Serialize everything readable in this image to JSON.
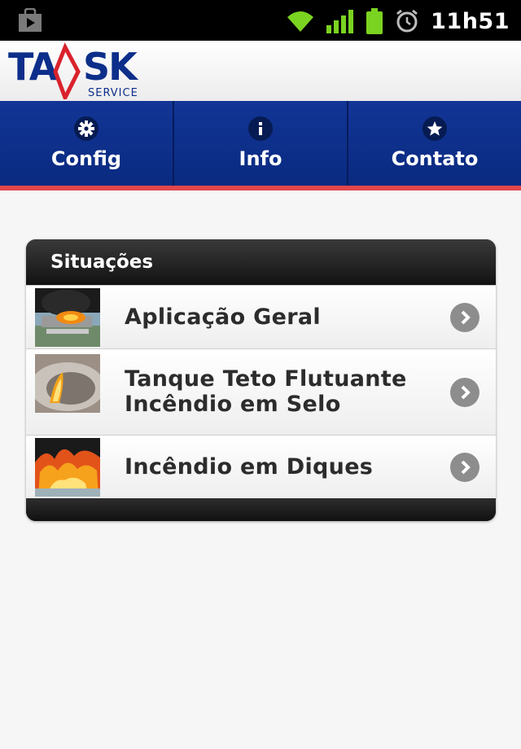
{
  "status_bar": {
    "time": "11h51",
    "icons": [
      "play-store-icon",
      "wifi-icon",
      "signal-icon",
      "battery-icon",
      "alarm-icon"
    ],
    "colors": {
      "icons": "#7bd321",
      "background": "#000000"
    }
  },
  "header": {
    "logo_text": "TASK",
    "logo_subtext": "SERVICES",
    "logo_colors": {
      "text": "#0d2e8a",
      "accent": "#d9232d"
    }
  },
  "nav": {
    "items": [
      {
        "label": "Config",
        "icon": "gear-icon"
      },
      {
        "label": "Info",
        "icon": "info-icon"
      },
      {
        "label": "Contato",
        "icon": "star-icon"
      }
    ],
    "colors": {
      "background": "#0d2e8a",
      "underline": "#e0474c"
    }
  },
  "situations": {
    "title": "Situações",
    "items": [
      {
        "label": "Aplicação Geral",
        "thumbnail": "refinery-fire-thumbnail"
      },
      {
        "label_line1": "Tanque Teto Flutuante",
        "label_line2": "Incêndio em Selo",
        "thumbnail": "tank-seal-fire-thumbnail"
      },
      {
        "label": "Incêndio em Diques",
        "thumbnail": "dike-fire-thumbnail"
      }
    ]
  }
}
